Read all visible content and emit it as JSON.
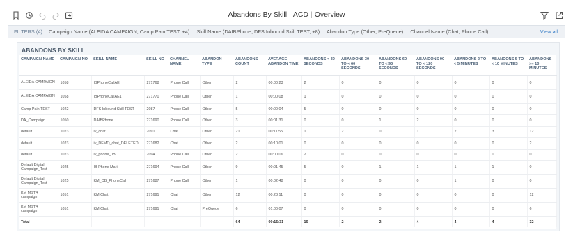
{
  "header": {
    "title_main": "Abandons By Skill",
    "title_sub1": "ACD",
    "title_sub2": "Overview",
    "left_icons": [
      "bookmark-icon",
      "history-icon",
      "undo-icon",
      "redo-icon",
      "export-icon"
    ],
    "right_icons": [
      "filter-icon",
      "share-icon"
    ]
  },
  "filters": {
    "label": "FILTERS (4)",
    "items": [
      "Campaign Name (ALEIDA CAMPAIGN, Camp Pain TEST, +4)",
      "Skill Name (DAIBPhone, DFS Inbound Skill TEST, +8)",
      "Abandon Type (Other, PreQueue)",
      "Channel Name (Chat, Phone Call)"
    ],
    "view_all": "View all"
  },
  "panel": {
    "title": "ABANDONS BY SKILL",
    "columns": [
      "CAMPAIGN NAME",
      "CAMPAIGN NO",
      "SKILL NAME",
      "SKILL NO",
      "CHANNEL NAME",
      "ABANDON TYPE",
      "ABANDONS COUNT",
      "AVERAGE ABANDON TIME",
      "ABANDONS < 30 SECONDS",
      "ABANDONS 30 TO < 60 SECONDS",
      "ABANDONS 60 TO < 90 SECONDS",
      "ABANDONS 90 TO < 120 SECONDS",
      "ABANDONS 2 TO < 5 MINUTES",
      "ABANDONS 5 TO < 10 MINUTES",
      "ABANDONS >= 10 MINUTES"
    ],
    "rows": [
      [
        "ALEIDA CAMPAIGN",
        "1058",
        "IBPhoneCallAE",
        "271768",
        "Phone Call",
        "Other",
        "2",
        "00:00:23",
        "2",
        "0",
        "0",
        "0",
        "0",
        "0",
        "0"
      ],
      [
        "ALEIDA CAMPAIGN",
        "1058",
        "IBPhoneCallAE1",
        "271770",
        "Phone Call",
        "Other",
        "1",
        "00:00:08",
        "1",
        "0",
        "0",
        "0",
        "0",
        "0",
        "0"
      ],
      [
        "Camp Pain TEST",
        "1022",
        "DFS Inbound Skill TEST",
        "2087",
        "Phone Call",
        "Other",
        "5",
        "00:00:04",
        "5",
        "0",
        "0",
        "0",
        "0",
        "0",
        "0"
      ],
      [
        "DA_Campaign",
        "1050",
        "DAIBPhone",
        "271690",
        "Phone Call",
        "Other",
        "3",
        "00:01:31",
        "0",
        "0",
        "1",
        "2",
        "0",
        "0",
        "0"
      ],
      [
        "default",
        "1023",
        "iv_chat",
        "2091",
        "Chat",
        "Other",
        "21",
        "00:11:55",
        "1",
        "2",
        "0",
        "1",
        "2",
        "3",
        "12"
      ],
      [
        "default",
        "1023",
        "iv_DEMO_chat_DELETED",
        "271682",
        "Chat",
        "Other",
        "2",
        "00:10:01",
        "0",
        "0",
        "0",
        "0",
        "0",
        "0",
        "2"
      ],
      [
        "default",
        "1023",
        "iv_phone_JB",
        "2094",
        "Phone Call",
        "Other",
        "2",
        "00:00:06",
        "2",
        "0",
        "0",
        "0",
        "0",
        "0",
        "0"
      ],
      [
        "Default Digital Campaign_Test",
        "1025",
        "IB Phone Mari",
        "271694",
        "Phone Call",
        "Other",
        "9",
        "00:01:45",
        "5",
        "0",
        "1",
        "1",
        "1",
        "1",
        "0"
      ],
      [
        "Default Digital Campaign_Test",
        "1025",
        "KM_OB_PhoneCall",
        "271687",
        "Phone Call",
        "Other",
        "1",
        "00:02:48",
        "0",
        "0",
        "0",
        "0",
        "1",
        "0",
        "0"
      ],
      [
        "KM MSTR campaign",
        "1051",
        "KM Chat",
        "271691",
        "Chat",
        "Other",
        "12",
        "00:28:11",
        "0",
        "0",
        "0",
        "0",
        "0",
        "0",
        "12"
      ],
      [
        "KM MSTR campaign",
        "1051",
        "KM Chat",
        "271691",
        "Chat",
        "PreQueue",
        "6",
        "01:00:07",
        "0",
        "0",
        "0",
        "0",
        "0",
        "0",
        "6"
      ]
    ],
    "total": [
      "Total",
      "",
      "",
      "",
      "",
      "",
      "64",
      "00:15:31",
      "16",
      "2",
      "2",
      "4",
      "4",
      "4",
      "32"
    ]
  }
}
